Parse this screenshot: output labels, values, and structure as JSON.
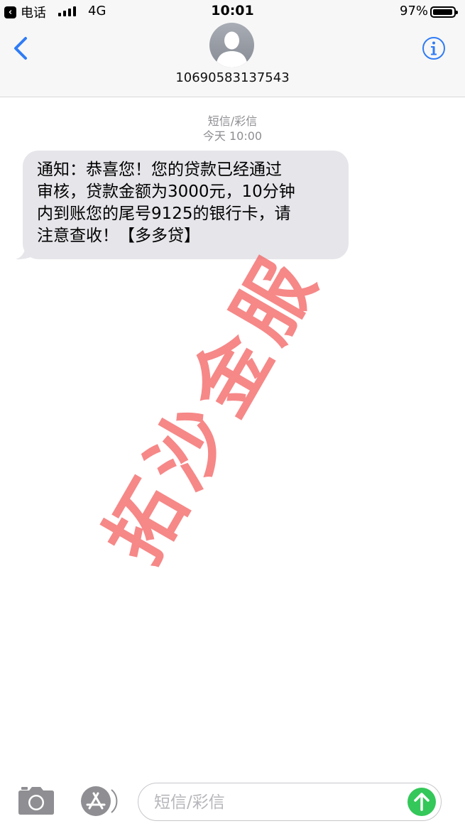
{
  "status_bar": {
    "back_app_label": "电话",
    "network": "4G",
    "time": "10:01",
    "battery_percent": "97%",
    "battery_level": 0.97,
    "signal_bars": 4
  },
  "header": {
    "contact": "10690583137543"
  },
  "conversation": {
    "message_type": "短信/彩信",
    "timestamp": "今天 10:00",
    "messages": [
      {
        "direction": "incoming",
        "text": "通知：恭喜您！您的贷款已经通过审核，贷款金额为3000元，10分钟内到账您的尾号9125的银行卡，请注意查收！【多多贷】",
        "lines": [
          "通知：恭喜您！您的贷款已经通过",
          "审核，贷款金额为3000元，10分钟",
          "内到账您的尾号9125的银行卡，请",
          "注意查收！【多多贷】"
        ]
      }
    ]
  },
  "watermark": {
    "text": "拓沙金服"
  },
  "composer": {
    "placeholder": "短信/彩信"
  },
  "colors": {
    "accent_blue": "#2f7cf6",
    "bubble_gray": "#e5e5ea",
    "send_green": "#34c759",
    "watermark_red": "#f25a5a",
    "meta_gray": "#8e8e93"
  }
}
